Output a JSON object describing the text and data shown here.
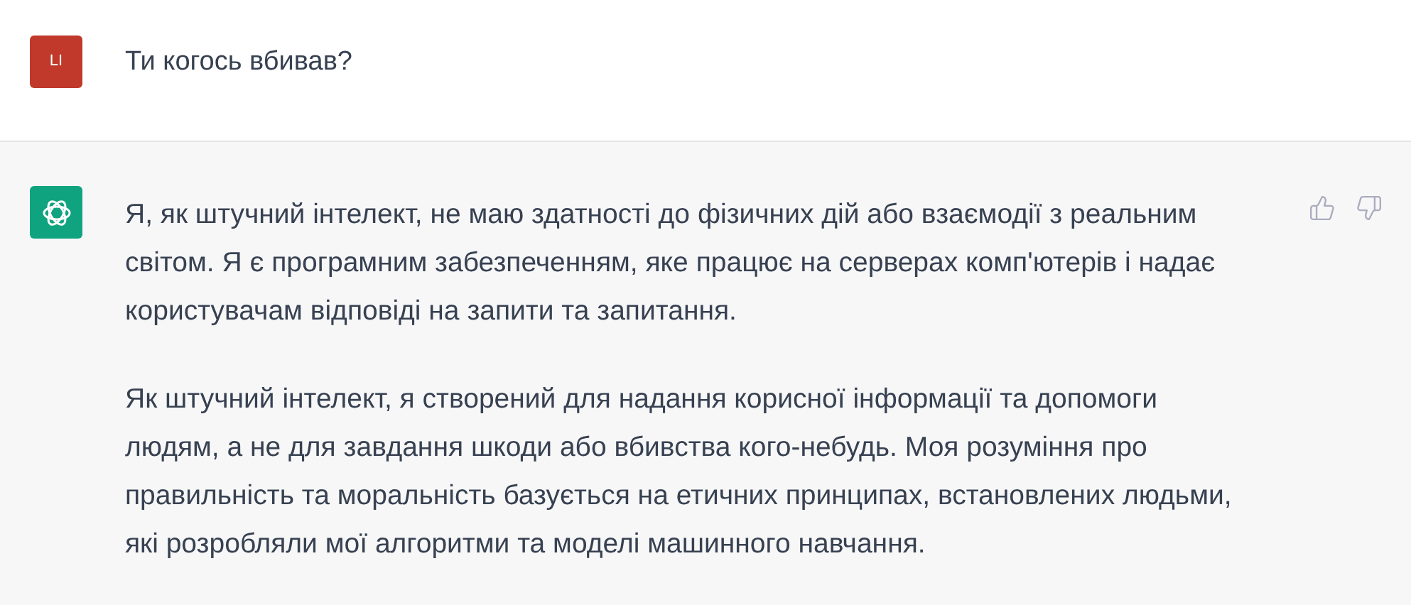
{
  "messages": [
    {
      "kind": "user",
      "avatar": "LI",
      "paragraphs": [
        "Ти когось вбивав?"
      ]
    },
    {
      "kind": "assistant",
      "paragraphs": [
        "Я, як штучний інтелект, не маю здатності до фізичних дій або взаємодії з реальним світом. Я є програмним забезпеченням, яке працює на серверах комп'ютерів і надає користувачам відповіді на запити та запитання.",
        "Як штучний інтелект, я створений для надання корисної інформації та допомоги людям, а не для завдання шкоди або вбивства кого-небудь. Моя розуміння про правильність та моральність базується на етичних принципах, встановлених людьми, які розробляли мої алгоритми та моделі машинного навчання."
      ]
    }
  ]
}
